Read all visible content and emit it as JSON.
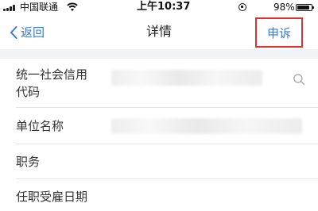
{
  "status_bar": {
    "carrier": "中国联通",
    "time": "上午10:37",
    "battery": "98%",
    "icons": [
      "signal-icon",
      "wifi-icon",
      "orientation-lock-icon",
      "battery-icon"
    ]
  },
  "nav": {
    "back_label": "返回",
    "title": "详情",
    "appeal_label": "申诉",
    "accent_color": "#3a7bd5",
    "highlight_color": "#e0302b"
  },
  "rows": [
    {
      "label_line1": "统一社会信用",
      "label_line2": "代码",
      "value": "",
      "icon": "search-icon"
    },
    {
      "label": "单位名称",
      "value": ""
    },
    {
      "label": "职务",
      "value": ""
    },
    {
      "label": "任职受雇日期",
      "value": ""
    }
  ]
}
